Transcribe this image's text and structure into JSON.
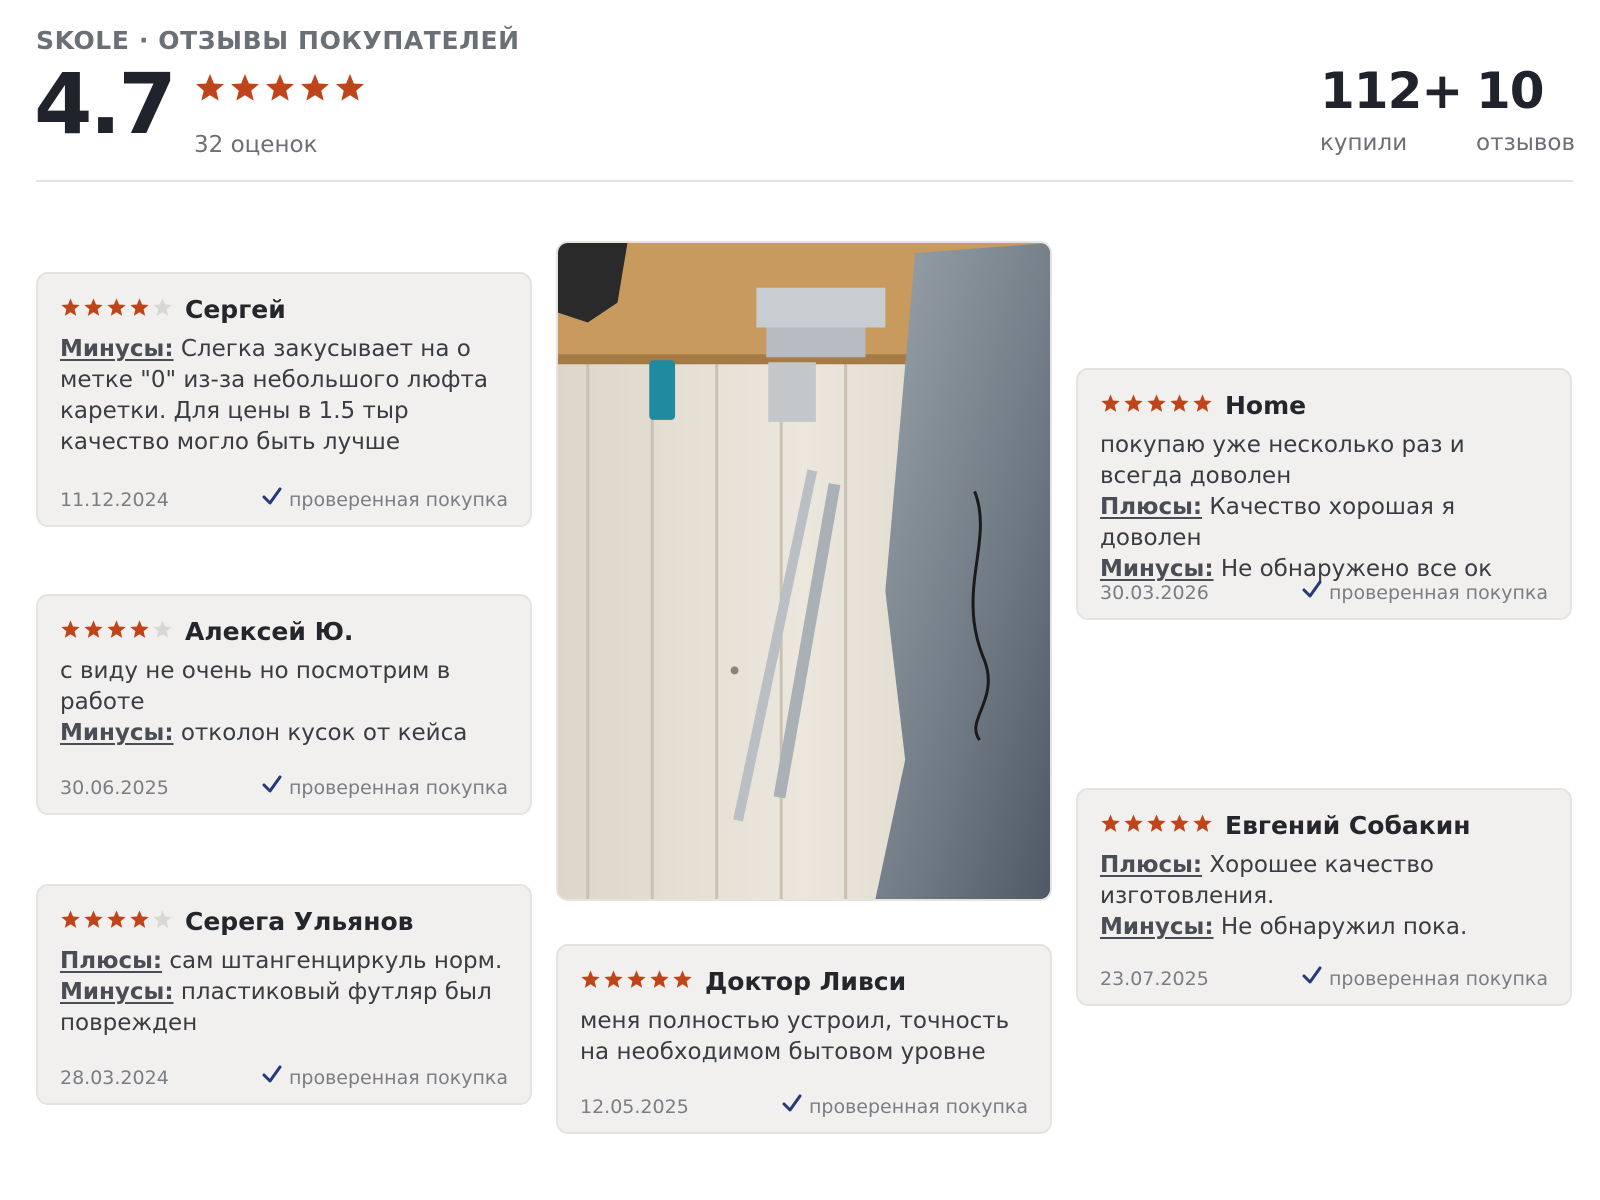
{
  "header": {
    "brand_title": "SKOLE · ОТЗЫВЫ ПОКУПАТЕЛЕЙ",
    "rating_value": "4.7",
    "rating_stars": 5,
    "rating_count": "32 оценок",
    "bought_count": "112+",
    "bought_label": "купили",
    "reviews_count": "10",
    "reviews_label": "отзывов"
  },
  "colors": {
    "star_filled": "#c0441a",
    "star_empty": "#d9d7d4",
    "check": "#253a7a",
    "card_bg": "#f1f0ee"
  },
  "icons": {
    "rating_star": "star-icon",
    "verified": "checkmark-icon"
  },
  "reviews": [
    {
      "author": "Сергей",
      "stars": 4,
      "minus_label": "Минусы:",
      "minus_text": " Слегка закусывает на о метке \"0\" из-за небольшого люфта каретки. Для цены в 1.5 тыр качество могло быть лучше",
      "date": "11.12.2024",
      "verified_text": "проверенная покупка"
    },
    {
      "author": "Алексей Ю.",
      "stars": 4,
      "text": "с виду не очень но посмотрим в работе",
      "minus_label": "Минусы:",
      "minus_text": " отколон кусок от кейса",
      "date": "30.06.2025",
      "verified_text": "проверенная покупка"
    },
    {
      "author": "Серега Ульянов",
      "stars": 4,
      "plus_label": "Плюсы:",
      "plus_text": " сам штангенциркуль норм.",
      "minus_label": "Минусы:",
      "minus_text": " пластиковый футляр был поврежден",
      "date": "28.03.2024",
      "verified_text": "проверенная покупка"
    },
    {
      "author": "Доктор Ливси",
      "stars": 5,
      "text": "меня полностью устроил, точность на необходимом бытовом уровне",
      "date": "12.05.2025",
      "verified_text": "проверенная покупка"
    },
    {
      "author": "Home",
      "stars": 5,
      "text": "￼покупаю уже несколько раз и всегда доволен",
      "plus_label": "Плюсы:",
      "plus_text": " Качество хорошая я доволен",
      "minus_label": "Минусы:",
      "minus_text": " Не обнаружено все ок",
      "date": "30.03.2026",
      "verified_text": "проверенная покупка"
    },
    {
      "author": "Евгений Собакин",
      "stars": 5,
      "plus_label": "Плюсы:",
      "plus_text": " Хорошее качество изготовления.",
      "minus_label": "Минусы:",
      "minus_text": " Не обнаружил пока.",
      "date": "23.07.2025",
      "verified_text": "проверенная покупка"
    }
  ]
}
